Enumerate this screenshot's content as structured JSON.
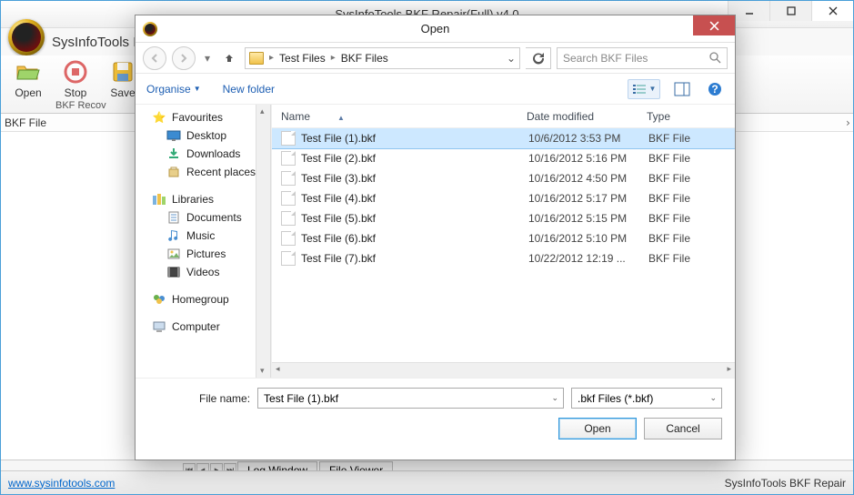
{
  "main": {
    "title": "SysInfoTools BKF Repair(Full) v4.0",
    "brand": "SysInfoTools I",
    "ribbon": {
      "open": "Open",
      "stop": "Stop",
      "save": "Save",
      "group": "BKF Recov"
    },
    "panel": "BKF File",
    "tabs": {
      "log": "Log Window",
      "viewer": "File Viewer"
    },
    "status_link": "www.sysinfotools.com",
    "status_right": "SysInfoTools BKF Repair"
  },
  "dialog": {
    "title": "Open",
    "breadcrumb": [
      "Test Files",
      "BKF Files"
    ],
    "search_placeholder": "Search BKF Files",
    "toolbar": {
      "organise": "Organise",
      "newfolder": "New folder"
    },
    "sidebar": {
      "favourites": "Favourites",
      "fav_items": [
        "Desktop",
        "Downloads",
        "Recent places"
      ],
      "libraries": "Libraries",
      "lib_items": [
        "Documents",
        "Music",
        "Pictures",
        "Videos"
      ],
      "homegroup": "Homegroup",
      "computer": "Computer"
    },
    "columns": {
      "name": "Name",
      "date": "Date modified",
      "type": "Type"
    },
    "rows": [
      {
        "name": "Test File (1).bkf",
        "date": "10/6/2012 3:53 PM",
        "type": "BKF File",
        "selected": true
      },
      {
        "name": "Test File (2).bkf",
        "date": "10/16/2012 5:16 PM",
        "type": "BKF File"
      },
      {
        "name": "Test File (3).bkf",
        "date": "10/16/2012 4:50 PM",
        "type": "BKF File"
      },
      {
        "name": "Test File (4).bkf",
        "date": "10/16/2012 5:17 PM",
        "type": "BKF File"
      },
      {
        "name": "Test File (5).bkf",
        "date": "10/16/2012 5:15 PM",
        "type": "BKF File"
      },
      {
        "name": "Test File (6).bkf",
        "date": "10/16/2012 5:10 PM",
        "type": "BKF File"
      },
      {
        "name": "Test File (7).bkf",
        "date": "10/22/2012 12:19 ...",
        "type": "BKF File"
      }
    ],
    "filename_label": "File name:",
    "filename_value": "Test File (1).bkf",
    "filter": ".bkf Files (*.bkf)",
    "open_btn": "Open",
    "cancel_btn": "Cancel"
  }
}
